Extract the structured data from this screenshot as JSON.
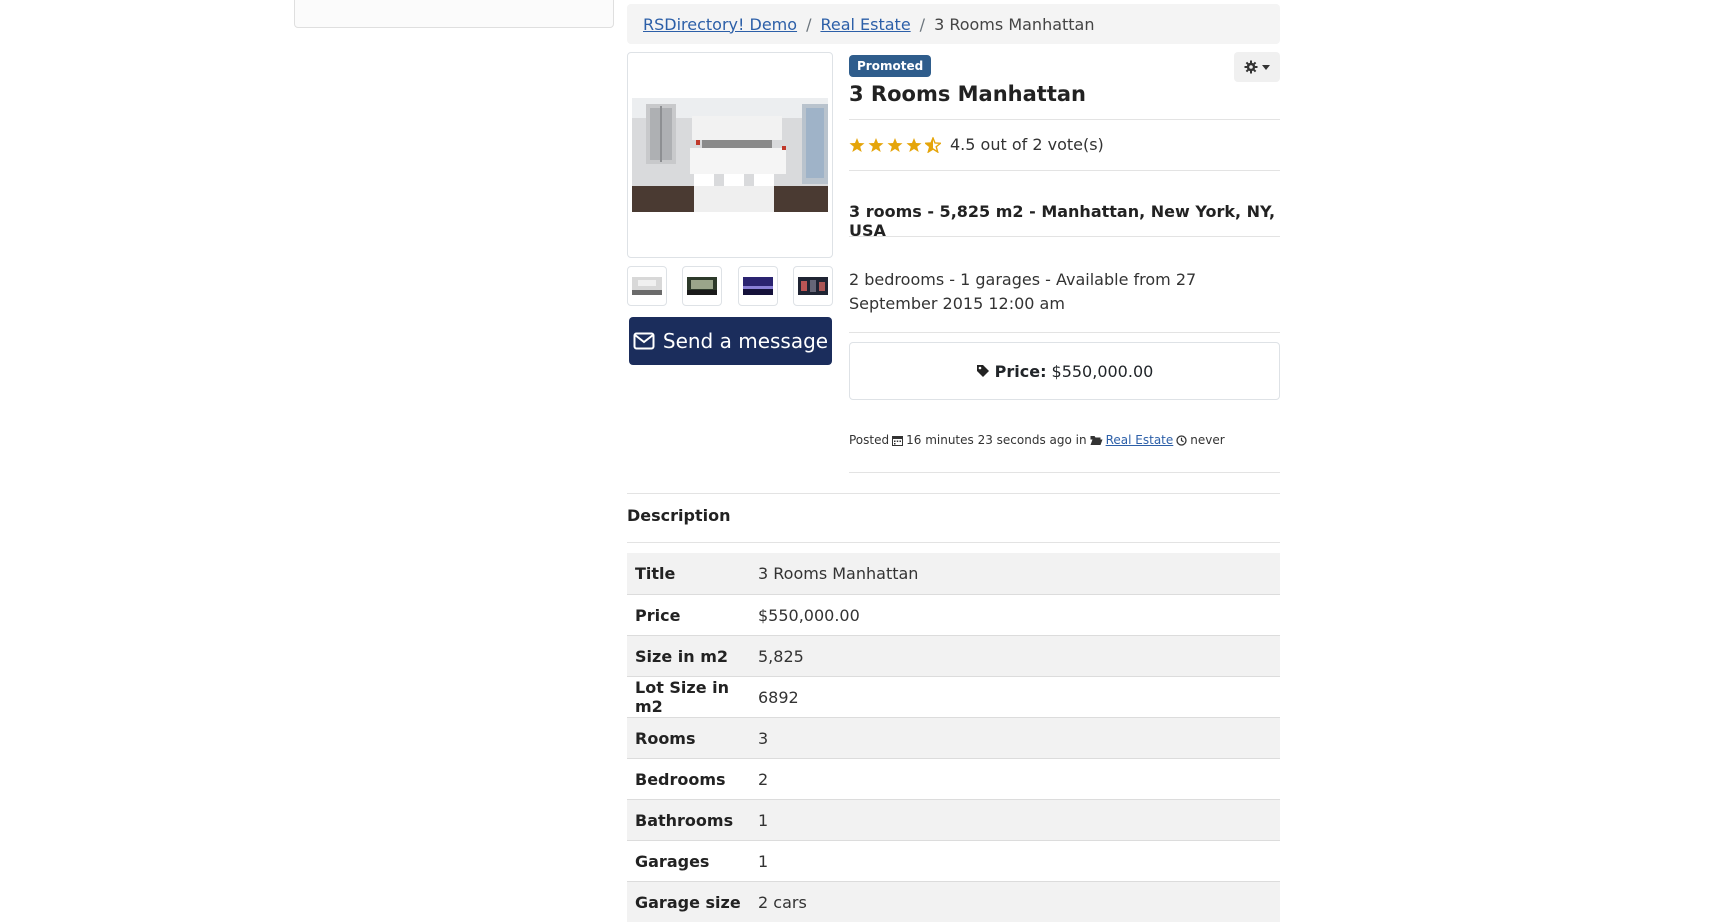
{
  "breadcrumb": {
    "items": [
      "RSDirectory! Demo",
      "Real Estate"
    ],
    "separator": "/",
    "current": "3 Rooms Manhattan"
  },
  "listing": {
    "badge": "Promoted",
    "title": "3 Rooms Manhattan",
    "rating": {
      "value": 4.5,
      "max": 5,
      "text": "4.5 out of 2 vote(s)"
    },
    "summary": "3 rooms - 5,825 m2 - Manhattan, New York, NY, USA",
    "details": "2 bedrooms - 1 garages - Available from 27 September 2015 12:00 am",
    "price_label": "Price:",
    "price_value": "$550,000.00",
    "posted": {
      "prefix": "Posted",
      "ago": "16 minutes 23 seconds ago in",
      "category": "Real Estate",
      "expires": "never"
    }
  },
  "gallery": {
    "thumbs_count": 4
  },
  "send_message_label": "Send a message",
  "description": {
    "title": "Description",
    "rows": [
      {
        "key": "Title",
        "value": "3 Rooms Manhattan"
      },
      {
        "key": "Price",
        "value": "$550,000.00"
      },
      {
        "key": "Size in m2",
        "value": "5,825"
      },
      {
        "key": "Lot Size in m2",
        "value": "6892"
      },
      {
        "key": "Rooms",
        "value": "3"
      },
      {
        "key": "Bedrooms",
        "value": "2"
      },
      {
        "key": "Bathrooms",
        "value": "1"
      },
      {
        "key": "Garages",
        "value": "1"
      },
      {
        "key": "Garage size",
        "value": "2 cars"
      }
    ]
  },
  "colors": {
    "accent": "#1b2d5c",
    "badge": "#2f5d8c",
    "star": "#e5a50a",
    "link": "#2c5fa8"
  }
}
